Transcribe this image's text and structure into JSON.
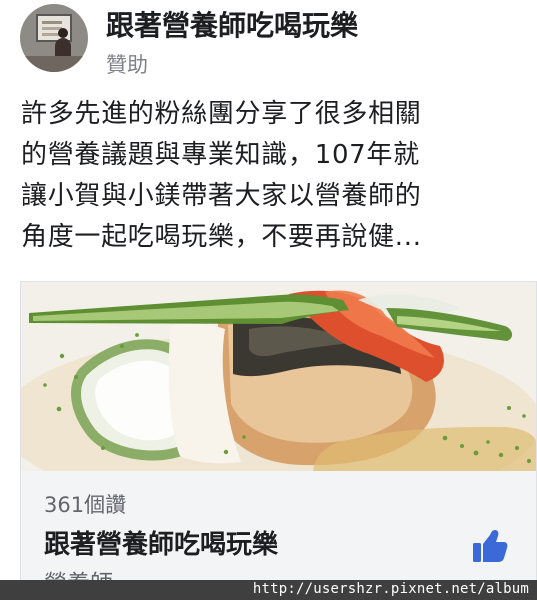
{
  "post": {
    "page_name": "跟著營養師吃喝玩樂",
    "sponsored_label": "贊助",
    "text_lines": [
      "許多先進的粉絲團分享了很多相關",
      "的營養議題與專業知識，107年就",
      "讓小賀與小鎂帶著大家以營養師的",
      "角度一起吃喝玩樂，不要再說健..."
    ]
  },
  "link_card": {
    "likes": "361個讚",
    "title": "跟著營養師吃喝玩樂",
    "category": "營養師"
  },
  "watermark": {
    "text": "http://usershzr.pixnet.net/album"
  },
  "colors": {
    "text_primary": "#1c1e21",
    "text_secondary": "#62666c",
    "facebook_blue": "#3b69d8",
    "card_background": "#f3f4f6"
  },
  "icons": {
    "like": "thumbs-up-icon",
    "avatar": "page-avatar-image"
  }
}
